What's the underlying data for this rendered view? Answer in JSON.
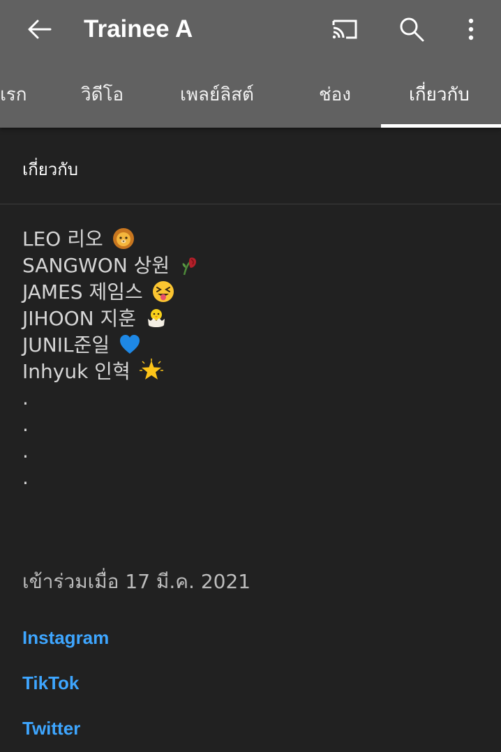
{
  "header": {
    "title": "Trainee A",
    "icons": [
      "back-arrow-icon",
      "cast-icon",
      "search-icon",
      "more-vert-icon"
    ]
  },
  "tabs": [
    {
      "label": "แรก",
      "selected": false
    },
    {
      "label": "วิดีโอ",
      "selected": false
    },
    {
      "label": "เพลย์ลิสต์",
      "selected": false
    },
    {
      "label": "ช่อง",
      "selected": false
    },
    {
      "label": "เกี่ยวกับ",
      "selected": true
    }
  ],
  "section": {
    "title": "เกี่ยวกับ"
  },
  "description": [
    {
      "text": "LEO 리오",
      "emoji": "lion-emoji"
    },
    {
      "text": "SANGWON 상원",
      "emoji": "wilted-rose-emoji"
    },
    {
      "text": "JAMES 제임스",
      "emoji": "squinting-tongue-emoji"
    },
    {
      "text": "JIHOON 지훈",
      "emoji": "hatching-chick-emoji"
    },
    {
      "text": "JUNIL준일",
      "emoji": "blue-heart-emoji"
    },
    {
      "text": "Inhyuk 인혁",
      "emoji": "glowing-star-emoji"
    },
    {
      "text": "."
    },
    {
      "text": "."
    },
    {
      "text": "."
    },
    {
      "text": "."
    }
  ],
  "joined": "เข้าร่วมเมื่อ 17 มี.ค. 2021",
  "links": [
    "Instagram",
    "TikTok",
    "Twitter"
  ],
  "colors": {
    "header_bg": "#616161",
    "page_bg": "#212121",
    "link": "#3ea6ff",
    "text_primary": "#ffffff",
    "text_secondary": "#d6d6d6"
  }
}
